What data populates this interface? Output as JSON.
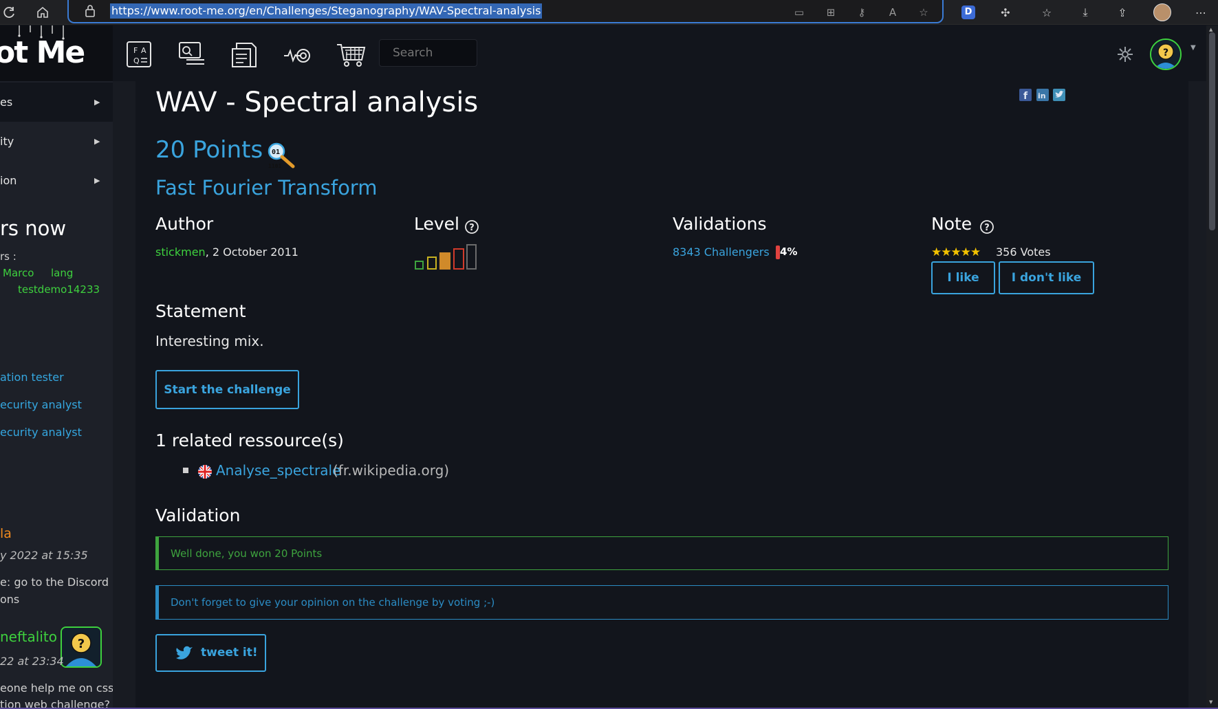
{
  "browser": {
    "url": "https://www.root-me.org/en/Challenges/Steganography/WAV-Spectral-analysis"
  },
  "logo": {
    "text": "ot Me"
  },
  "sidebar": {
    "nav": [
      {
        "label": "es"
      },
      {
        "label": "ity"
      },
      {
        "label": "ion"
      }
    ],
    "online_heading": "rs now",
    "online_label": "rs :",
    "online_users": [
      "Marco",
      "lang",
      "testdemo14233"
    ],
    "links": [
      "ation tester",
      "ecurity analyst",
      "ecurity analyst"
    ],
    "chat": {
      "msg1_user": "la",
      "msg1_date": "y 2022 at 15:35",
      "msg1_text_1": "e: go to the Discord",
      "msg1_text_2": "ons",
      "msg2_user": "neftalito",
      "msg2_date": "22 at 23:34",
      "msg2_text_1": "eone help me on css",
      "msg2_text_2": "tion web challenge?"
    }
  },
  "topnav": {
    "search_placeholder": "Search"
  },
  "challenge": {
    "title": "WAV - Spectral analysis",
    "points": "20 Points",
    "subtitle": "Fast Fourier Transform",
    "author_heading": "Author",
    "author_name": "stickmen",
    "author_date": ",  2 October 2011",
    "level_heading": "Level",
    "level": 3,
    "level_max": 5,
    "validations_heading": "Validations",
    "validations_link": "8343 Challengers",
    "validations_pct": "4%",
    "note_heading": "Note",
    "stars": "★★★★★",
    "votes": "356 Votes",
    "like_label": "I like",
    "dislike_label": "I don't like",
    "statement_heading": "Statement",
    "statement_text": "Interesting mix.",
    "start_label": "Start the challenge",
    "resources_heading": "1 related ressource(s)",
    "resource_link": "Analyse_spectrale",
    "resource_domain": "(fr.wikipedia.org)",
    "validation_heading": "Validation",
    "success_msg": "Well done, you won 20 Points",
    "info_msg": "Don't forget to give your opinion on the challenge by voting ;-)",
    "tweet_label": "tweet it!"
  },
  "colors": {
    "accent": "#3aa4de",
    "success": "#3ea43e",
    "online": "#3ed13e",
    "star": "#f2c200",
    "danger": "#e0423f"
  }
}
